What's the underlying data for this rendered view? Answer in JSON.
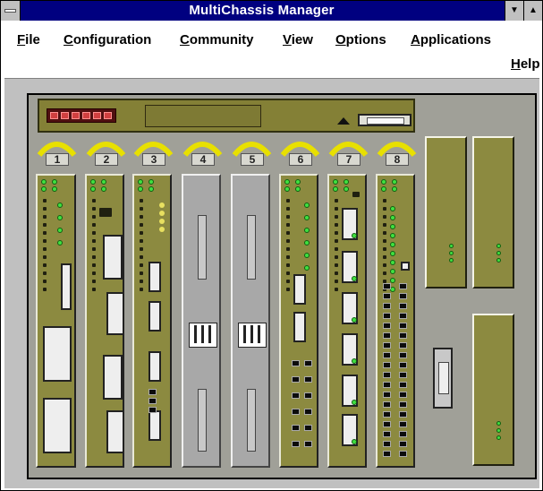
{
  "window": {
    "title": "MultiChassis Manager"
  },
  "menu": {
    "file": "File",
    "configuration": "Configuration",
    "community": "Community",
    "view": "View",
    "options": "Options",
    "applications": "Applications",
    "help": "Help"
  },
  "chassis": {
    "slots": [
      "1",
      "2",
      "3",
      "4",
      "5",
      "6",
      "7",
      "8"
    ]
  },
  "colors": {
    "titlebar": "#000080",
    "module": "#8c8a40",
    "led_green": "#40e040",
    "slot_tag": "#e8e000"
  }
}
